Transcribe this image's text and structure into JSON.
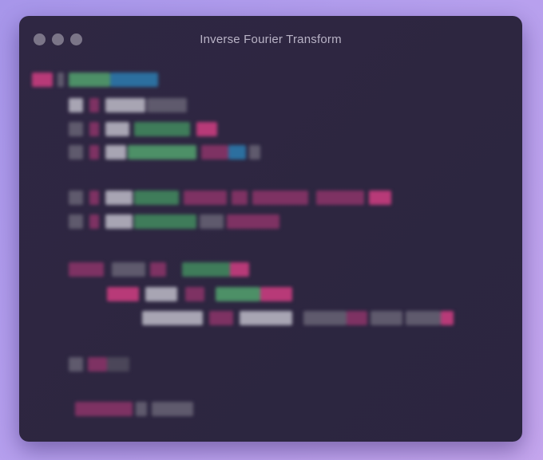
{
  "window": {
    "title": "Inverse Fourier Transform"
  },
  "traffic_lights": [
    "close",
    "minimize",
    "maximize"
  ],
  "code_editor": {
    "content_state": "blurred",
    "token_colors": {
      "keyword": "#b83a78",
      "function": "#3f7c5a",
      "builtin": "#2c6f9f",
      "identifier": "#a8a5b3",
      "operator": "#5f5a6d"
    }
  }
}
